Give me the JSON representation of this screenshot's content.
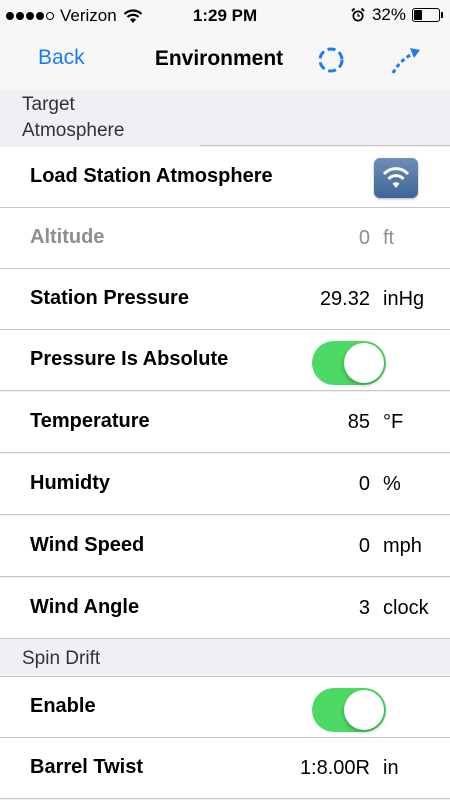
{
  "status_bar": {
    "carrier": "Verizon",
    "time": "1:29 PM",
    "battery": "32%",
    "signal_bars_filled": 4,
    "signal_bars_total": 5
  },
  "nav": {
    "back_label": "Back",
    "title": "Environment",
    "refresh_icon": "refresh-circle-icon",
    "trajectory_icon": "trajectory-arrow-icon",
    "accent_color": "#1a7cf5"
  },
  "sections": {
    "target_title_line1": "Target",
    "target_title_line2": "Atmosphere",
    "spin_title": "Spin Drift"
  },
  "rows": {
    "load_station": {
      "label": "Load Station Atmosphere",
      "icon": "wifi-icon"
    },
    "altitude": {
      "label": "Altitude",
      "value": "0",
      "unit": "ft"
    },
    "station_pressure": {
      "label": "Station Pressure",
      "value": "29.32",
      "unit": "inHg"
    },
    "pressure_absolute": {
      "label": "Pressure Is Absolute",
      "on": true
    },
    "temperature": {
      "label": "Temperature",
      "value": "85",
      "unit": "°F"
    },
    "humidity": {
      "label": "Humidty",
      "value": "0",
      "unit": "%"
    },
    "wind_speed": {
      "label": "Wind Speed",
      "value": "0",
      "unit": "mph"
    },
    "wind_angle": {
      "label": "Wind Angle",
      "value": "3",
      "unit": "clock"
    },
    "enable": {
      "label": "Enable",
      "on": true
    },
    "barrel_twist": {
      "label": "Barrel Twist",
      "value": "1:8.00R",
      "unit": "in"
    }
  },
  "colors": {
    "toggle_on": "#4cd964",
    "disabled_text": "#8e8e93"
  }
}
